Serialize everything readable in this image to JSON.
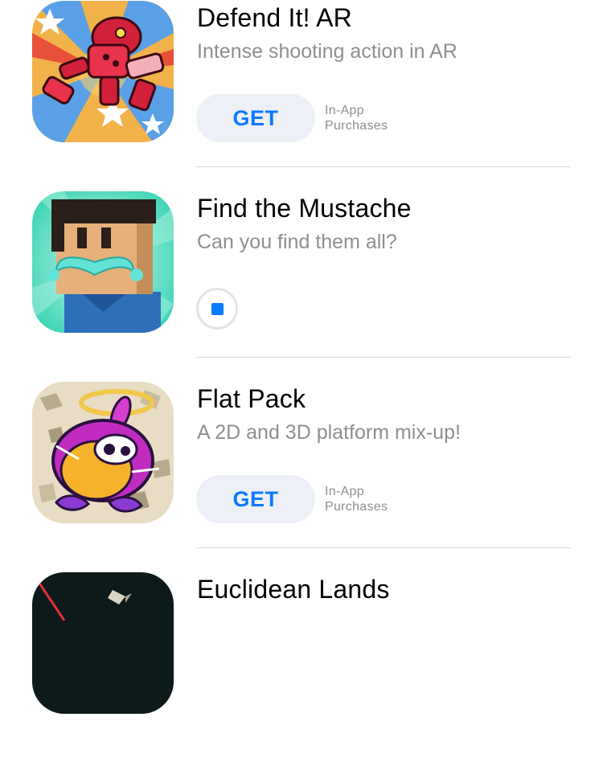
{
  "apps": [
    {
      "title": "Defend It! AR",
      "subtitle": "Intense shooting action in AR",
      "action": "GET",
      "iap_line1": "In-App",
      "iap_line2": "Purchases",
      "icon": "robot-app-icon"
    },
    {
      "title": "Find the Mustache",
      "subtitle": "Can you find them all?",
      "action": "stop-download",
      "icon": "mustache-character-app-icon"
    },
    {
      "title": "Flat Pack",
      "subtitle": "A 2D and 3D platform mix-up!",
      "action": "GET",
      "iap_line1": "In-App",
      "iap_line2": "Purchases",
      "icon": "flat-pack-creature-app-icon"
    },
    {
      "title": "Euclidean Lands",
      "icon": "euclidean-lands-app-icon"
    }
  ],
  "colors": {
    "accent": "#0a7aff",
    "button_bg": "#eef0f7",
    "subtitle": "#8e8e93",
    "divider": "#d8d8dc"
  }
}
